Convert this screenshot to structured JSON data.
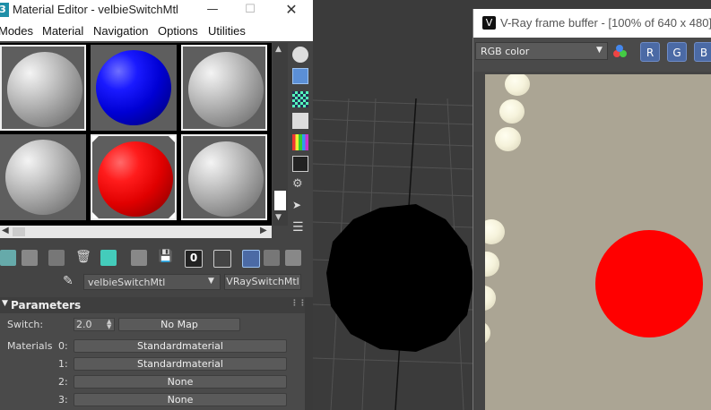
{
  "material_editor": {
    "title": "Material Editor - velbieSwitchMtl",
    "menu": [
      "Modes",
      "Material",
      "Navigation",
      "Options",
      "Utilities"
    ],
    "material_name": "velbieSwitchMtl",
    "material_type": "VRaySwitchMtl",
    "rollout_title": "Parameters",
    "switch_label": "Switch:",
    "switch_value": "2.0",
    "switch_map": "No Map",
    "materials_label": "Materials",
    "materials": [
      {
        "index": "0:",
        "value": "Standardmaterial"
      },
      {
        "index": "1:",
        "value": "Standardmaterial"
      },
      {
        "index": "2:",
        "value": "None"
      },
      {
        "index": "3:",
        "value": "None"
      }
    ],
    "slots": [
      "grey",
      "blue",
      "grey",
      "grey",
      "red",
      "grey"
    ],
    "active_slot": 4
  },
  "vfb": {
    "title": "V-Ray frame buffer - [100% of 640 x 480]",
    "channel": "RGB color",
    "channel_buttons": [
      "R",
      "G",
      "B"
    ]
  },
  "colors": {
    "render_bg": "#aba594",
    "accent_red": "#ff0000",
    "accent_blue": "#0000ff"
  }
}
